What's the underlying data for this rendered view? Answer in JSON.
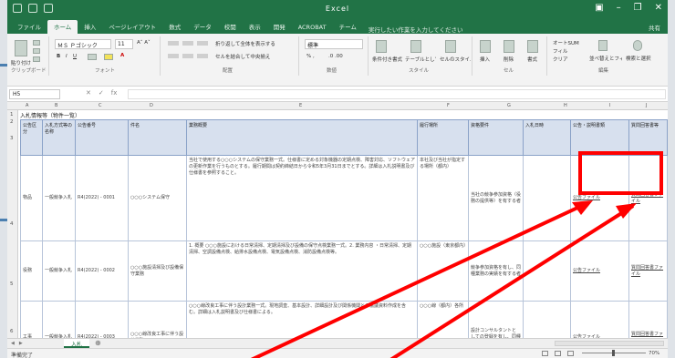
{
  "app": {
    "title": "Excel",
    "tabs": [
      "ファイル",
      "ホーム",
      "挿入",
      "ページレイアウト",
      "数式",
      "データ",
      "校閲",
      "表示",
      "開発",
      "ACROBAT",
      "チーム"
    ],
    "active_tab_index": 1,
    "tell_me": "実行したい作業を入力してください",
    "share": "共有"
  },
  "ribbon": {
    "groups": [
      "クリップボード",
      "フォント",
      "配置",
      "数値",
      "スタイル",
      "セル",
      "編集"
    ],
    "paste_label": "貼り付け",
    "font_name": "ＭＳ Ｐゴシック",
    "font_size": "11",
    "wrap_text": "折り返して全体を表示する",
    "merge_center": "セルを結合して中央揃え",
    "number_format": "標準",
    "conditional_format": "条件付き書式",
    "format_as_table": "テーブルとして書式設定",
    "cell_styles": "セルのスタイル",
    "insert": "挿入",
    "delete": "削除",
    "format": "書式",
    "autosum": "オートSUM",
    "fill": "フィル",
    "clear": "クリア",
    "sort_filter": "並べ替えとフィルター",
    "find_select": "検索と選択"
  },
  "formula_bar": {
    "name_box": "H5",
    "fx": "fx"
  },
  "columns": [
    "A",
    "B",
    "C",
    "D",
    "E",
    "F",
    "G",
    "H",
    "I",
    "J"
  ],
  "rows": [
    "1",
    "2",
    "3",
    "4",
    "5",
    "6"
  ],
  "sheet": {
    "title": "入札情報等（物件一覧）",
    "headers": [
      "公告区分",
      "入札方式等の名称",
      "公告番号",
      "件名",
      "業務概要",
      "履行場所",
      "資格要件",
      "入札日時",
      "公告・説明書類",
      "質問回答書等"
    ],
    "rows": [
      {
        "kubun": "物品",
        "method": "一般競争入札",
        "number": "R4(2022) - 0001",
        "subject": "○○○システム保守",
        "desc": "当社で使用する○○○システムの保守業務一式。仕様書に定める対象機器の定期点検、障害対応、ソフトウェアの更新作業を行うものとする。履行期間は契約締結日から令和5年3月31日までとする。詳細は入札説明書及び仕様書を参照すること。",
        "area": "本社及び当社が指定する場所（都内）",
        "req": "当社の競争参加資格（役務の提供等）を有する者",
        "schedule": "",
        "notice": "公告ファイル",
        "qa": "質問回答書ファイル"
      },
      {
        "kubun": "役務",
        "method": "一般競争入札",
        "number": "R4(2022) - 0002",
        "subject": "○○○施設清掃及び設備保守業務",
        "desc": "1. 概要 ○○○施設における日常清掃、定期清掃及び設備の保守点検業務一式。2. 業務内容 ・日常清掃、定期清掃、空調設備点検、給排水設備点検、電気設備点検、消防設備点検等。",
        "area": "○○○施設（東京都内）",
        "req": "競争参加資格を有し、同種業務の実績を有する者",
        "schedule": "",
        "notice": "公告ファイル",
        "qa": "質問回答書ファイル"
      },
      {
        "kubun": "工事",
        "method": "一般競争入札",
        "number": "R4(2022) - 0003",
        "subject": "○○○線改良工事に伴う設計業務",
        "desc": "○○○線改良工事に伴う設計業務一式。現地調査、基本設計、詳細設計及び関係機関との協議資料作成を含む。詳細は入札説明書及び仕様書による。",
        "area": "○○○線（都内）各所",
        "req": "設計コンサルタントとしての登録を有し、同種業務の実績を有する者",
        "schedule": "",
        "notice": "公告ファイル",
        "qa": "質問回答書ファイル"
      }
    ]
  },
  "sheet_tab": "入札",
  "status": {
    "ready": "準備完了",
    "zoom": "70%"
  },
  "annotation_color": "#ff0000"
}
